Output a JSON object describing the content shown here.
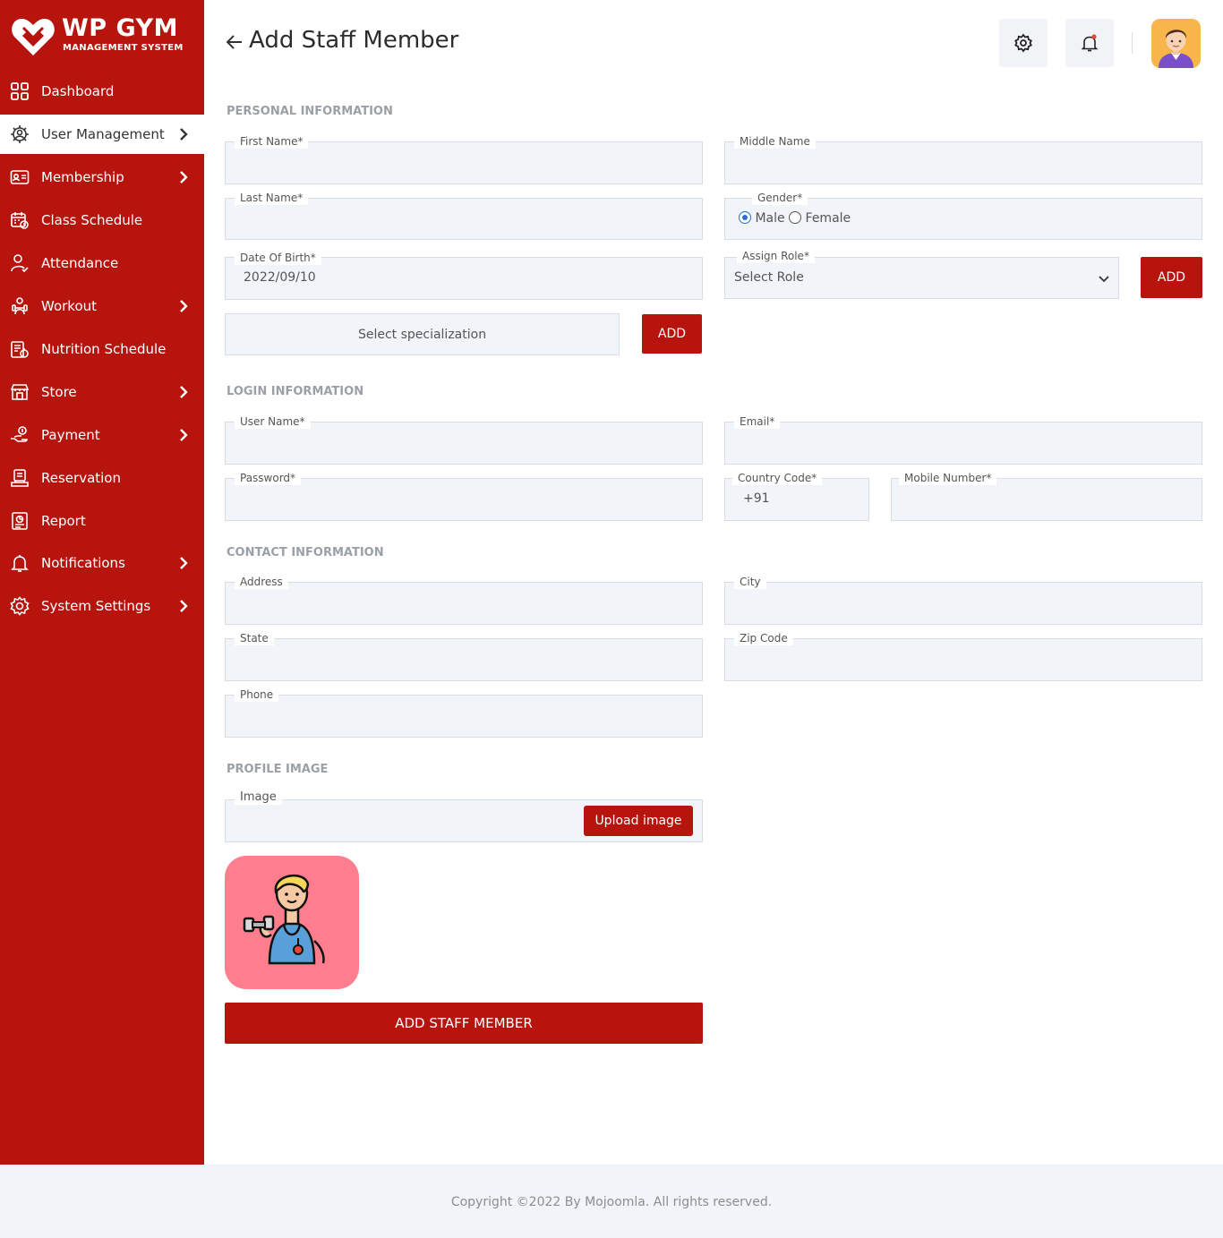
{
  "brand": {
    "title": "WP GYM",
    "subtitle": "MANAGEMENT SYSTEM"
  },
  "sidebar": {
    "items": [
      {
        "label": "Dashboard",
        "icon": "dashboard-icon"
      },
      {
        "label": "User Management",
        "icon": "users-gear-icon"
      },
      {
        "label": "Membership",
        "icon": "membership-card-icon"
      },
      {
        "label": "Class Schedule",
        "icon": "calendar-icon"
      },
      {
        "label": "Attendance",
        "icon": "user-check-icon"
      },
      {
        "label": "Workout",
        "icon": "workout-icon"
      },
      {
        "label": "Nutrition Schedule",
        "icon": "nutrition-icon"
      },
      {
        "label": "Store",
        "icon": "store-icon"
      },
      {
        "label": "Payment",
        "icon": "payment-icon"
      },
      {
        "label": "Reservation",
        "icon": "reservation-icon"
      },
      {
        "label": "Report",
        "icon": "report-icon"
      },
      {
        "label": "Notifications",
        "icon": "bell-icon"
      },
      {
        "label": "System Settings",
        "icon": "gear-icon"
      }
    ]
  },
  "header": {
    "title": "Add Staff Member"
  },
  "sections": {
    "personal": "PERSONAL INFORMATION",
    "login": "LOGIN INFORMATION",
    "contact": "CONTACT INFORMATION",
    "profile": "PROFILE IMAGE"
  },
  "form": {
    "first_name": {
      "label": "First Name*",
      "value": ""
    },
    "middle_name": {
      "label": "Middle Name",
      "value": ""
    },
    "last_name": {
      "label": "Last Name*",
      "value": ""
    },
    "gender": {
      "label": "Gender*",
      "options": [
        "Male",
        "Female"
      ],
      "selected": "Male"
    },
    "dob": {
      "label": "Date Of Birth*",
      "value": "2022/09/10"
    },
    "role": {
      "label": "Assign Role*",
      "value": "Select Role"
    },
    "role_add": "ADD",
    "specialization": {
      "placeholder": "Select specialization"
    },
    "specialization_add": "ADD",
    "username": {
      "label": "User Name*",
      "value": ""
    },
    "email": {
      "label": "Email*",
      "value": ""
    },
    "password": {
      "label": "Password*",
      "value": ""
    },
    "country_code": {
      "label": "Country Code*",
      "value": "+91"
    },
    "mobile": {
      "label": "Mobile Number*",
      "value": ""
    },
    "address": {
      "label": "Address",
      "value": ""
    },
    "city": {
      "label": "City",
      "value": ""
    },
    "state": {
      "label": "State",
      "value": ""
    },
    "zip": {
      "label": "Zip Code",
      "value": ""
    },
    "phone": {
      "label": "Phone",
      "value": ""
    },
    "image": {
      "label": "Image"
    },
    "upload": "Upload image",
    "submit": "ADD STAFF MEMBER"
  },
  "footer": {
    "copyright": "Copyright ©2022 By Mojoomla. All rights reserved."
  },
  "colors": {
    "accent": "#b7140e",
    "field_bg": "#f1f4f8",
    "profile_bg": "#ff7e8e"
  }
}
